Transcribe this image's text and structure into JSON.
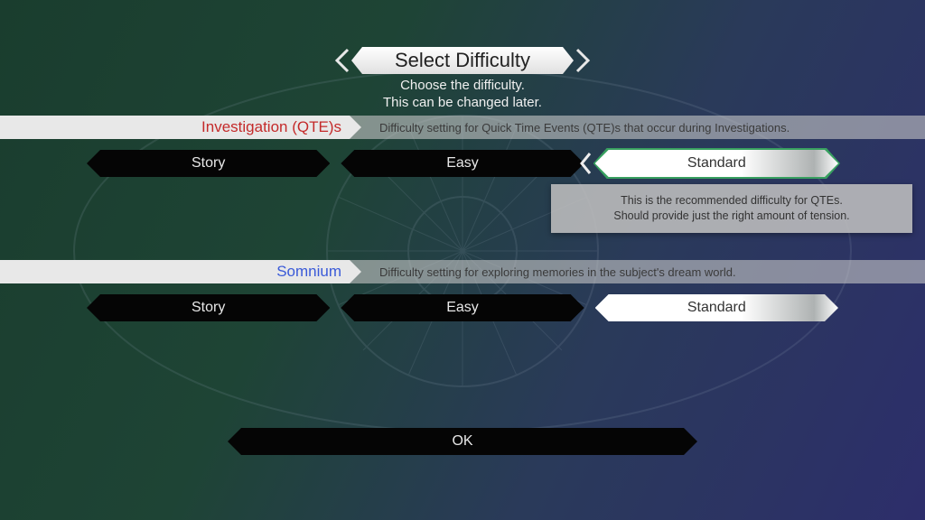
{
  "title": "Select Difficulty",
  "subtitle_line1": "Choose the difficulty.",
  "subtitle_line2": "This can be changed later.",
  "sections": {
    "investigation": {
      "label": "Investigation (QTE)s",
      "description": "Difficulty setting for Quick Time Events (QTE)s that occur during Investigations.",
      "options": {
        "story": "Story",
        "easy": "Easy",
        "standard": "Standard"
      },
      "selected": "standard",
      "tooltip_line1": "This is the recommended difficulty for QTEs.",
      "tooltip_line2": "Should provide just the right amount of tension."
    },
    "somnium": {
      "label": "Somnium",
      "description": "Difficulty setting for exploring memories in the subject's dream world.",
      "options": {
        "story": "Story",
        "easy": "Easy",
        "standard": "Standard"
      },
      "selected": "standard"
    }
  },
  "ok_label": "OK"
}
